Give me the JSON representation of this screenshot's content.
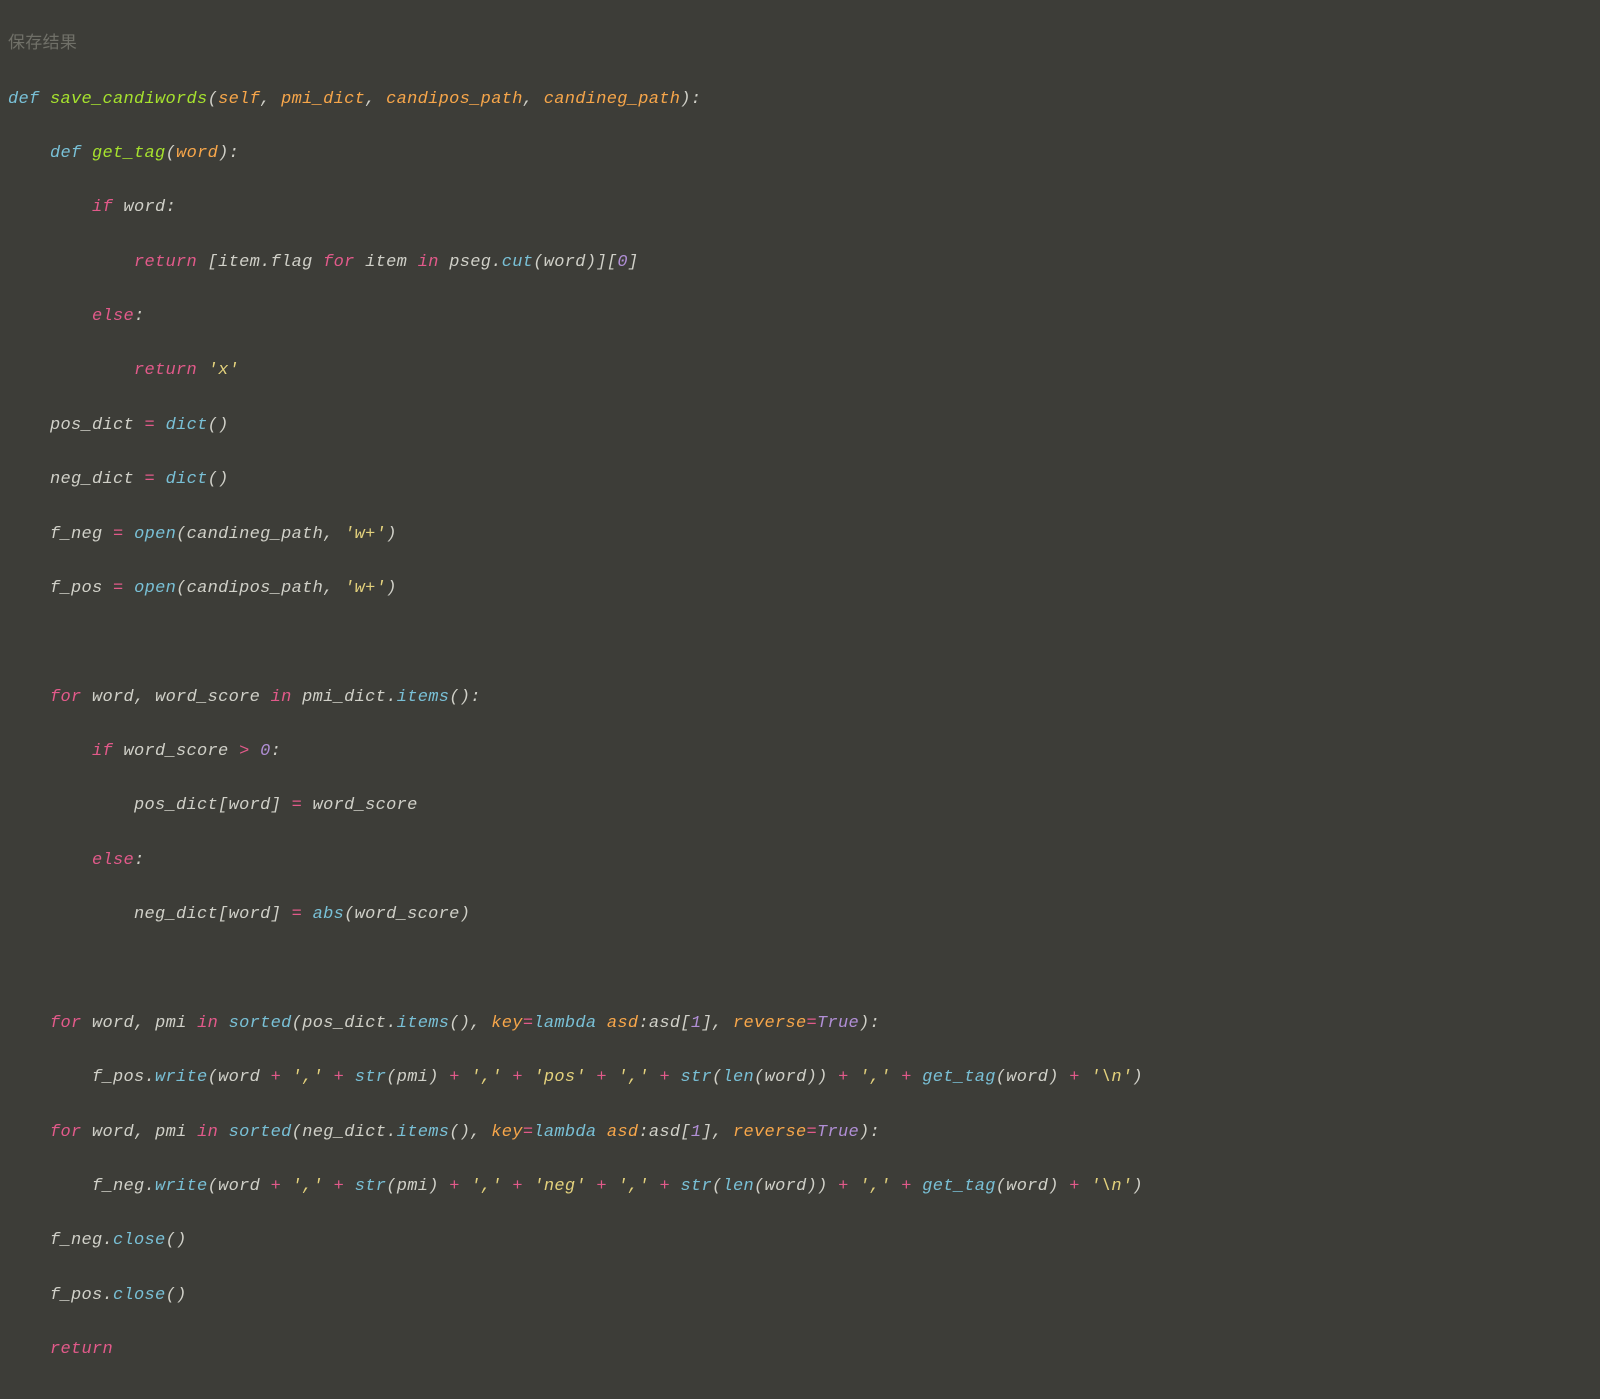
{
  "faded_header": "保存结果",
  "code": {
    "def": "def",
    "fn_save": "save_candiwords",
    "p_self": "self",
    "p_pmi_dict": "pmi_dict",
    "p_candipos": "candipos_path",
    "p_candineg": "candineg_path",
    "fn_get_tag": "get_tag",
    "p_word": "word",
    "kw_if": "if",
    "kw_else": "else",
    "kw_return": "return",
    "kw_for": "for",
    "kw_in": "in",
    "id_word": "word",
    "id_item": "item",
    "attr_flag": "flag",
    "id_pseg": "pseg",
    "call_cut": "cut",
    "idx0": "0",
    "str_x": "'x'",
    "id_pos_dict": "pos_dict",
    "id_neg_dict": "neg_dict",
    "call_dict": "dict",
    "id_f_neg": "f_neg",
    "id_f_pos": "f_pos",
    "call_open": "open",
    "id_candineg": "candineg_path",
    "id_candipos": "candipos_path",
    "str_wplus": "'w+'",
    "id_word_score": "word_score",
    "id_pmi_dict": "pmi_dict",
    "call_items": "items",
    "num0": "0",
    "call_abs": "abs",
    "id_pmi": "pmi",
    "call_sorted": "sorted",
    "kwarg_key": "key",
    "kw_lambda": "lambda",
    "id_asd": "asd",
    "idx1": "1",
    "kwarg_reverse": "reverse",
    "bool_true": "True",
    "call_write": "write",
    "call_str": "str",
    "call_len": "len",
    "call_get_tag": "get_tag",
    "str_comma": "','",
    "str_pos": "'pos'",
    "str_neg": "'neg'",
    "str_nl": "'\\n'",
    "call_close": "close",
    "eq": "=",
    "gt": ">",
    "plus": "+",
    "colon": ":",
    "lparen": "(",
    "rparen": ")",
    "lbrack": "[",
    "rbrack": "]",
    "comma": ",",
    "dot": "."
  }
}
